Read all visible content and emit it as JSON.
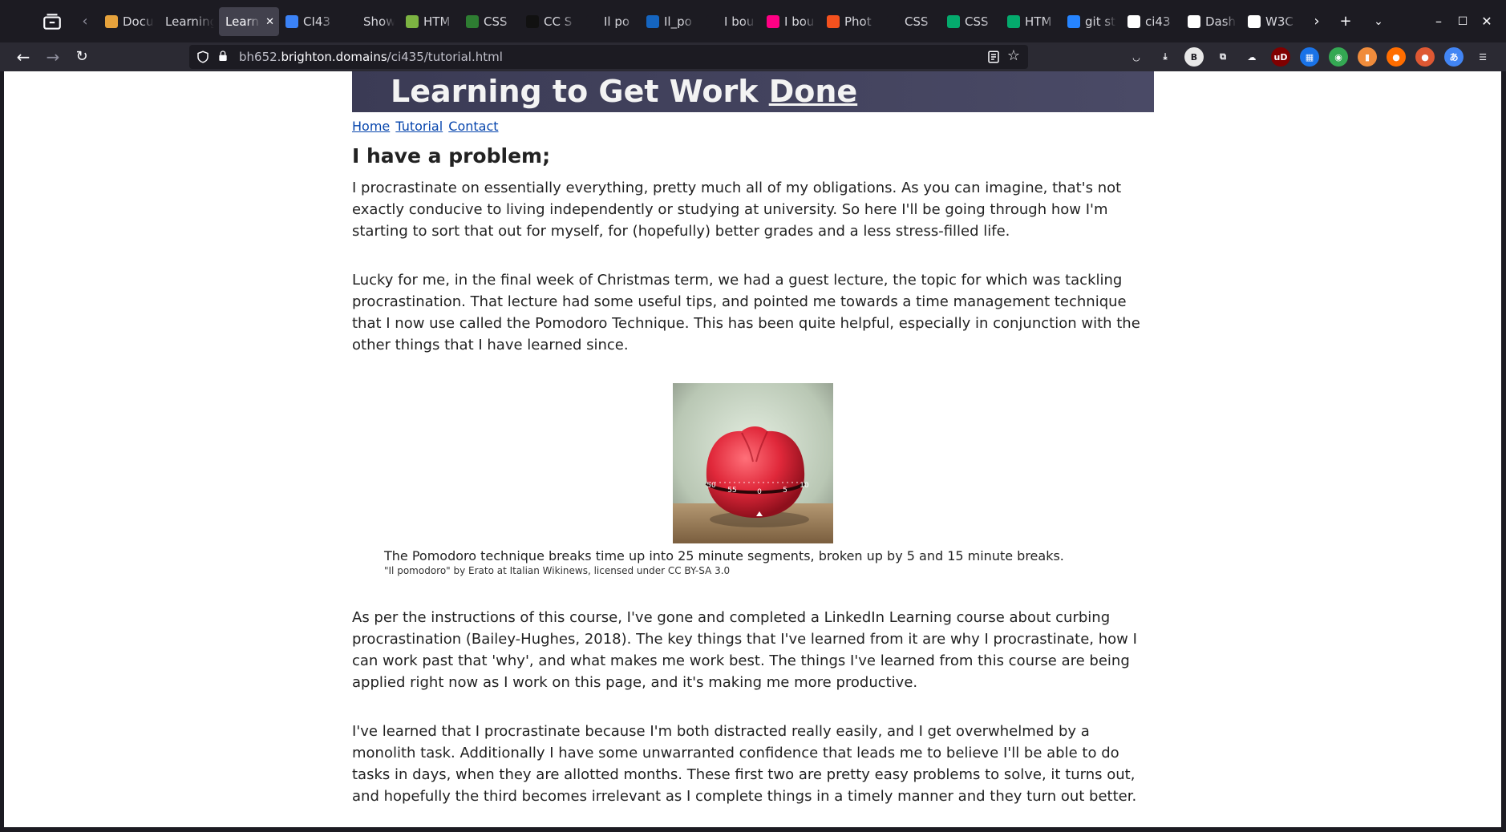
{
  "browser": {
    "tabs": [
      {
        "title": "Docu",
        "icon": "bar-chart-icon",
        "color": "#e6a23c"
      },
      {
        "title": "Learning",
        "icon": "",
        "color": ""
      },
      {
        "title": "Learn",
        "icon": "",
        "color": "",
        "active": true
      },
      {
        "title": "CI43",
        "icon": "bookmark-icon",
        "color": "#3b82f6"
      },
      {
        "title": "Show",
        "icon": "nu-icon",
        "color": "#1c1b22"
      },
      {
        "title": "HTM",
        "icon": "question-icon",
        "color": "#7cb342"
      },
      {
        "title": "CSS",
        "icon": "glasses-icon",
        "color": "#2e7d32"
      },
      {
        "title": "CC S",
        "icon": "cc-icon",
        "color": "#111111"
      },
      {
        "title": "Il po",
        "icon": "grid-icon",
        "color": "#1c1b22"
      },
      {
        "title": "Il_po",
        "icon": "wiki-icon",
        "color": "#1565c0"
      },
      {
        "title": "I bou",
        "icon": "grid-icon",
        "color": "#1c1b22"
      },
      {
        "title": "I bou",
        "icon": "flickr-icon",
        "color": "#ff0084"
      },
      {
        "title": "Phot",
        "icon": "pinwheel-icon",
        "color": "#f4511e"
      },
      {
        "title": "CSS",
        "icon": "m-icon",
        "color": "#1c1b22"
      },
      {
        "title": "CSS",
        "icon": "w-icon",
        "color": "#04aa6d"
      },
      {
        "title": "HTM",
        "icon": "w-icon",
        "color": "#04aa6d"
      },
      {
        "title": "git st",
        "icon": "atlassian-icon",
        "color": "#2684ff"
      },
      {
        "title": "ci43",
        "icon": "github-icon",
        "color": "#ffffff"
      },
      {
        "title": "Dash",
        "icon": "wordpress-icon",
        "color": "#ffffff"
      },
      {
        "title": "W3C",
        "icon": "w3c-icon",
        "color": "#ffffff"
      }
    ],
    "url_prefix": "bh652.",
    "url_domain": "brighton.domains",
    "url_path": "/ci435/tutorial.html",
    "toolbar_icons": [
      {
        "name": "pocket-icon",
        "glyph": "◡",
        "color": "transparent"
      },
      {
        "name": "download-icon",
        "glyph": "⤓",
        "color": "transparent"
      },
      {
        "name": "b-extension-icon",
        "glyph": "B",
        "color": "#e8e8e8"
      },
      {
        "name": "extensions-icon",
        "glyph": "⧉",
        "color": "transparent"
      },
      {
        "name": "cloud-icon",
        "glyph": "☁",
        "color": "transparent"
      },
      {
        "name": "ublock-icon",
        "glyph": "uD",
        "color": "#800000"
      },
      {
        "name": "grid-extension-icon",
        "glyph": "▦",
        "color": "#1a73e8"
      },
      {
        "name": "globe-extension-icon",
        "glyph": "◉",
        "color": "#34a853"
      },
      {
        "name": "trash-extension-icon",
        "glyph": "▮",
        "color": "#f08c3c"
      },
      {
        "name": "fox-extension-icon",
        "glyph": "●",
        "color": "#ff6d00"
      },
      {
        "name": "duck-extension-icon",
        "glyph": "●",
        "color": "#de5833"
      },
      {
        "name": "translate-extension-icon",
        "glyph": "あ",
        "color": "#4285f4"
      },
      {
        "name": "menu-icon",
        "glyph": "☰",
        "color": "transparent"
      }
    ]
  },
  "page": {
    "banner_title_main": "Learning to Get Work",
    "banner_title_link": "Done",
    "nav": {
      "home": "Home",
      "tutorial": "Tutorial",
      "contact": "Contact"
    },
    "heading": "I have a problem;",
    "paragraph_1": "I procrastinate on essentially everything, pretty much all of my obligations. As you can imagine, that's not exactly conducive to living independently or studying at university. So here I'll be going through how I'm starting to sort that out for myself, for (hopefully) better grades and a less stress-filled life.",
    "paragraph_2": "Lucky for me, in the final week of Christmas term, we had a guest lecture, the topic for which was tackling procrastination. That lecture had some useful tips, and pointed me towards a time management technique that I now use called the Pomodoro Technique. This has been quite helpful, especially in conjunction with the other things that I have learned since.",
    "figure_caption": "The Pomodoro technique breaks time up into 25 minute segments, broken up by 5 and 15 minute breaks.",
    "figure_credit": "\"Il pomodoro\" by Erato at Italian Wikinews, licensed under CC BY-SA 3.0",
    "paragraph_3": "As per the instructions of this course, I've gone and completed a LinkedIn Learning course about curbing procrastination (Bailey-Hughes, 2018). The key things that I've learned from it are why I procrastinate, how I can work past that 'why', and what makes me work best. The things I've learned from this course are being applied right now as I work on this page, and it's making me more productive.",
    "paragraph_4": "I've learned that I procrastinate because I'm both distracted really easily, and I get overwhelmed by a monolith task. Additionally I have some unwarranted confidence that leads me to believe I'll be able to do tasks in days, when they are allotted months. These first two are pretty easy problems to solve, it turns out, and hopefully the third becomes irrelevant as I complete things in a timely manner and they turn out better.",
    "timer_numbers": [
      "50",
      "55",
      "0",
      "5",
      "10"
    ]
  }
}
